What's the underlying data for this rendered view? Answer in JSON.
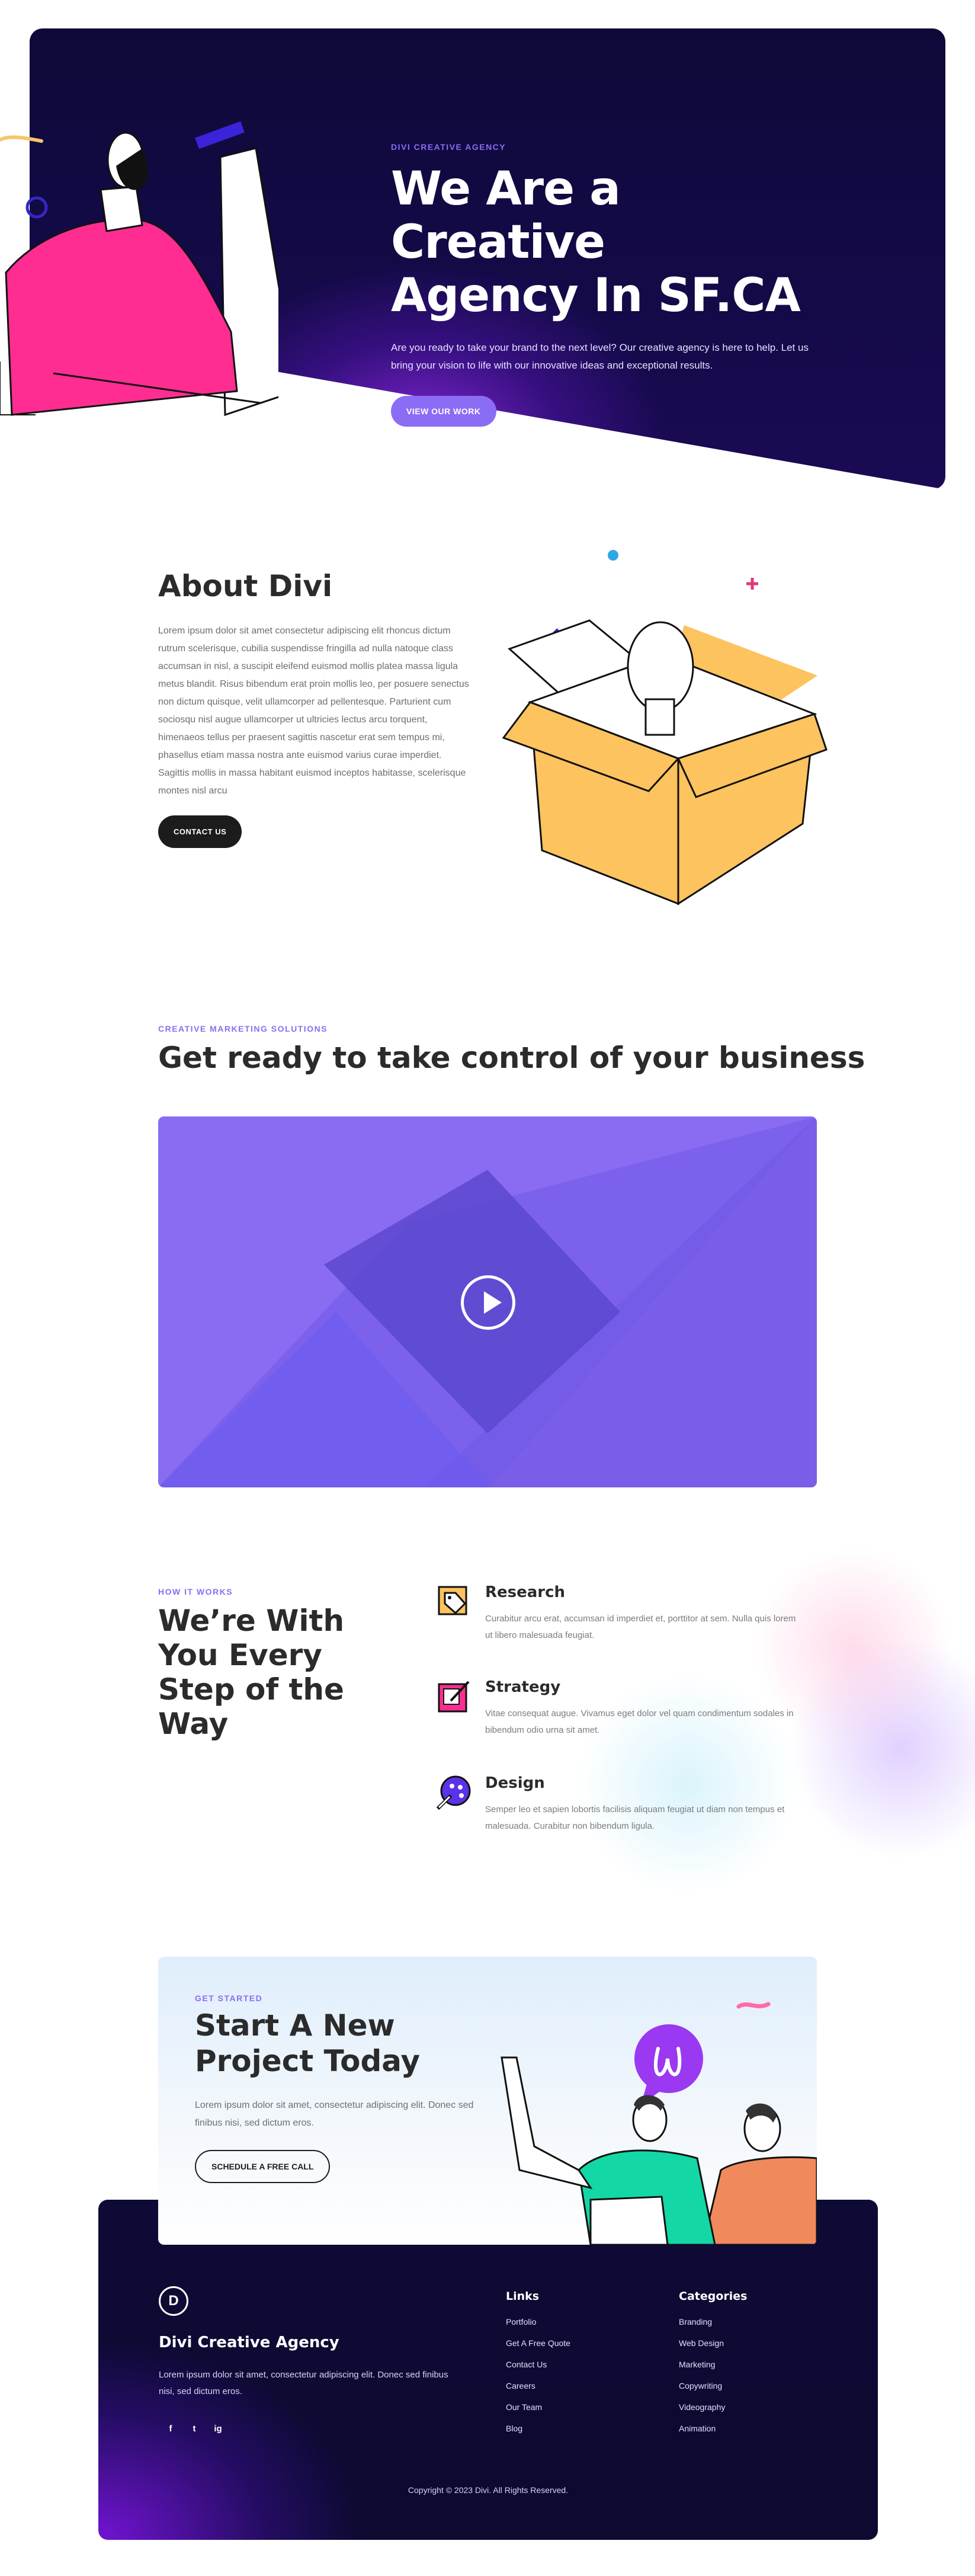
{
  "hero": {
    "eyebrow": "DIVI CREATIVE AGENCY",
    "title_line1": "We Are a Creative",
    "title_line2": "Agency In SF.CA",
    "description": "Are you ready to take your brand to the next level? Our creative agency is here to help. Let us bring your vision to life with our innovative ideas and exceptional results.",
    "button": "VIEW OUR WORK"
  },
  "about": {
    "title": "About Divi",
    "body": "Lorem ipsum dolor sit amet consectetur adipiscing elit rhoncus dictum rutrum scelerisque, cubilia suspendisse fringilla ad nulla natoque class accumsan in nisl, a suscipit eleifend euismod mollis platea massa ligula metus blandit. Risus bibendum erat proin mollis leo, per posuere senectus non dictum quisque, velit ullamcorper ad pellentesque. Parturient cum sociosqu nisl augue ullamcorper ut ultricies lectus arcu torquent, himenaeos tellus per praesent sagittis nascetur erat sem tempus mi, phasellus etiam massa nostra ante euismod varius curae imperdiet. Sagittis mollis in massa habitant euismod inceptos habitasse, scelerisque montes nisl arcu",
    "button": "CONTACT US"
  },
  "marketing": {
    "eyebrow": "CREATIVE MARKETING SOLUTIONS",
    "title": "Get ready to take control of your business"
  },
  "how_it_works": {
    "eyebrow": "HOW IT WORKS",
    "title": "We’re With You Every Step of the Way",
    "steps": [
      {
        "title": "Research",
        "text": "Curabitur arcu erat, accumsan id imperdiet et, porttitor at sem. Nulla quis lorem ut libero malesuada feugiat.",
        "icon": "tag-icon"
      },
      {
        "title": "Strategy",
        "text": "Vitae consequat augue. Vivamus eget dolor vel quam condimentum sodales in bibendum odio urna sit amet.",
        "icon": "checkbox-icon"
      },
      {
        "title": "Design",
        "text": "Semper leo et sapien lobortis facilisis aliquam feugiat ut diam non tempus et malesuada. Curabitur non bibendum ligula.",
        "icon": "palette-icon"
      }
    ]
  },
  "cta": {
    "eyebrow": "GET STARTED",
    "title_line1": "Start A New",
    "title_line2": "Project Today",
    "description": "Lorem ipsum dolor sit amet, consectetur adipiscing elit. Donec sed finibus nisi, sed dictum eros.",
    "button": "SCHEDULE A FREE CALL"
  },
  "footer": {
    "logo_letter": "D",
    "name": "Divi Creative Agency",
    "description": "Lorem ipsum dolor sit amet, consectetur adipiscing elit. Donec sed finibus nisi, sed dictum eros.",
    "social": [
      "f",
      "t",
      "ig"
    ],
    "links_title": "Links",
    "links": [
      "Portfolio",
      "Get A Free Quote",
      "Contact Us",
      "Careers",
      "Our Team",
      "Blog"
    ],
    "categories_title": "Categories",
    "categories": [
      "Branding",
      "Web Design",
      "Marketing",
      "Copywriting",
      "Videography",
      "Animation"
    ],
    "copyright": "Copyright © 2023 Divi. All Rights Reserved."
  },
  "colors": {
    "accent": "#8b6cf5",
    "hero_bg": "#0d0a3a",
    "dark_button": "#1c1c1c",
    "box_yellow": "#fcc35e",
    "shirt_pink": "#ff2d92"
  }
}
